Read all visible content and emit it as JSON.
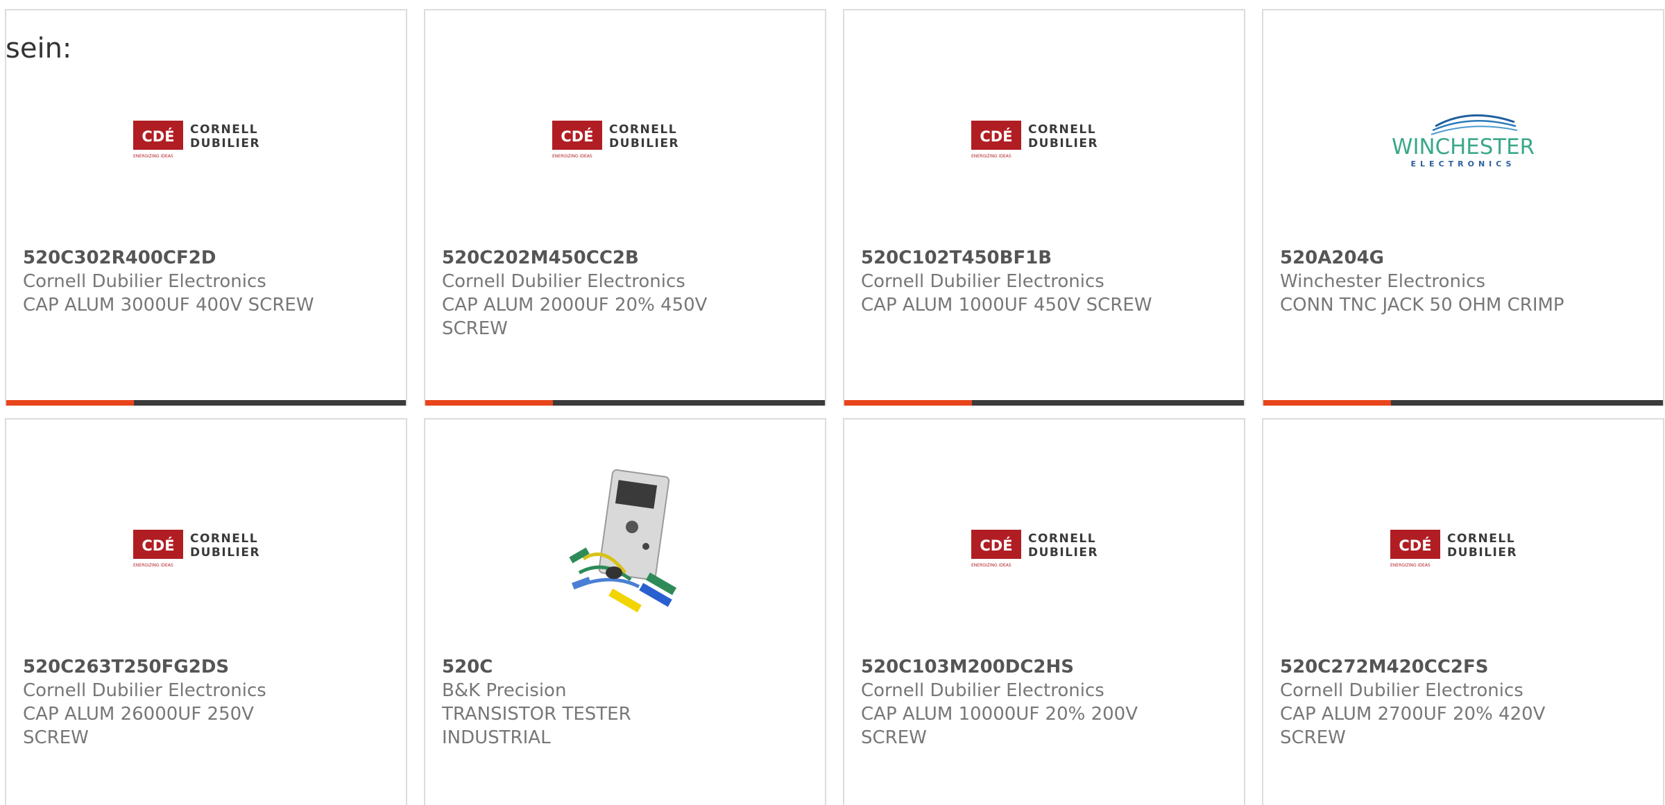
{
  "intro_text": "sein:",
  "colors": {
    "accent": "#e8451c",
    "bar": "#3b3b3b",
    "cde_red": "#b01e23"
  },
  "products": [
    {
      "part": "520C302R400CF2D",
      "maker": "Cornell Dubilier Electronics",
      "desc": "CAP ALUM 3000UF 400V SCREW",
      "logo": "cde"
    },
    {
      "part": "520C202M450CC2B",
      "maker": "Cornell Dubilier Electronics",
      "desc": "CAP ALUM 2000UF 20% 450V SCREW",
      "logo": "cde"
    },
    {
      "part": "520C102T450BF1B",
      "maker": "Cornell Dubilier Electronics",
      "desc": "CAP ALUM 1000UF 450V SCREW",
      "logo": "cde"
    },
    {
      "part": "520A204G",
      "maker": "Winchester Electronics",
      "desc": "CONN TNC JACK 50 OHM CRIMP",
      "logo": "winchester"
    },
    {
      "part": "520C263T250FG2DS",
      "maker": "Cornell Dubilier Electronics",
      "desc": "CAP ALUM 26000UF 250V SCREW",
      "logo": "cde"
    },
    {
      "part": "520C",
      "maker": "B&K Precision",
      "desc": "TRANSISTOR TESTER INDUSTRIAL",
      "logo": "tester-photo"
    },
    {
      "part": "520C103M200DC2HS",
      "maker": "Cornell Dubilier Electronics",
      "desc": "CAP ALUM 10000UF 20% 200V SCREW",
      "logo": "cde"
    },
    {
      "part": "520C272M420CC2FS",
      "maker": "Cornell Dubilier Electronics",
      "desc": "CAP ALUM 2700UF 20% 420V SCREW",
      "logo": "cde"
    }
  ],
  "logos": {
    "cde": {
      "mark": "CDÉ",
      "line1": "CORNELL",
      "line2": "DUBILIER",
      "tagline": "ENERGIZING IDEAS"
    },
    "winchester": {
      "name": "WINCHESTER",
      "sub": "ELECTRONICS"
    }
  }
}
